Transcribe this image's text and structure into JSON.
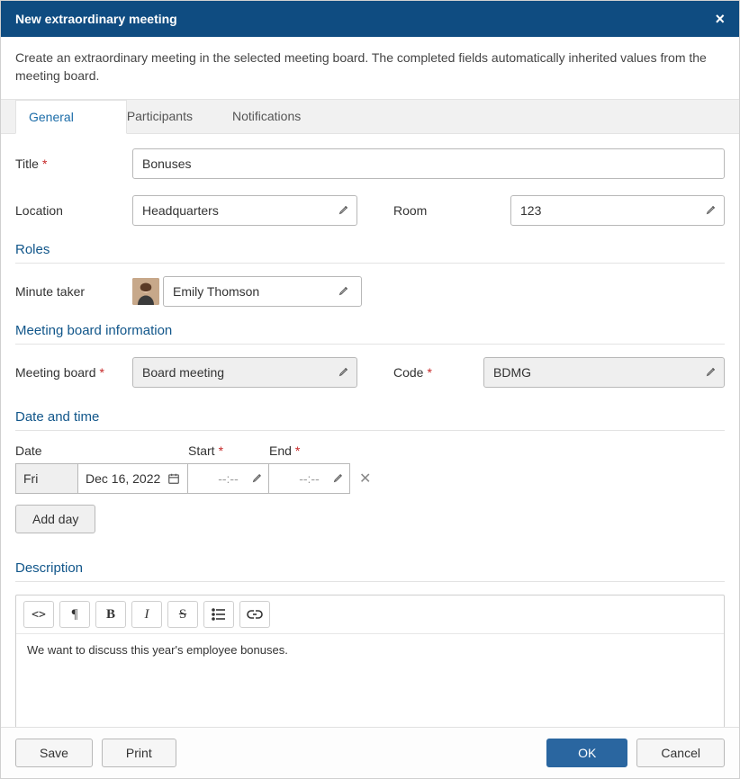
{
  "header": {
    "title": "New extraordinary meeting"
  },
  "subtitle": "Create an extraordinary meeting in the selected meeting board. The completed fields automatically inherited values from the meeting board.",
  "tabs": {
    "general": "General",
    "participants": "Participants",
    "notifications": "Notifications"
  },
  "labels": {
    "title": "Title",
    "location": "Location",
    "room": "Room",
    "roles": "Roles",
    "minuteTaker": "Minute taker",
    "mbiHeader": "Meeting board information",
    "meetingBoard": "Meeting board",
    "code": "Code",
    "dateTimeHeader": "Date and time",
    "date": "Date",
    "start": "Start",
    "end": "End",
    "addDay": "Add day",
    "description": "Description"
  },
  "values": {
    "title": "Bonuses",
    "location": "Headquarters",
    "room": "123",
    "minuteTaker": "Emily Thomson",
    "meetingBoard": "Board meeting",
    "code": "BDMG",
    "dayName": "Fri",
    "dateFull": "Dec 16, 2022",
    "startTime": "--:--",
    "endTime": "--:--",
    "descriptionText": "We want to discuss this year's employee bonuses."
  },
  "footer": {
    "save": "Save",
    "print": "Print",
    "ok": "OK",
    "cancel": "Cancel"
  }
}
